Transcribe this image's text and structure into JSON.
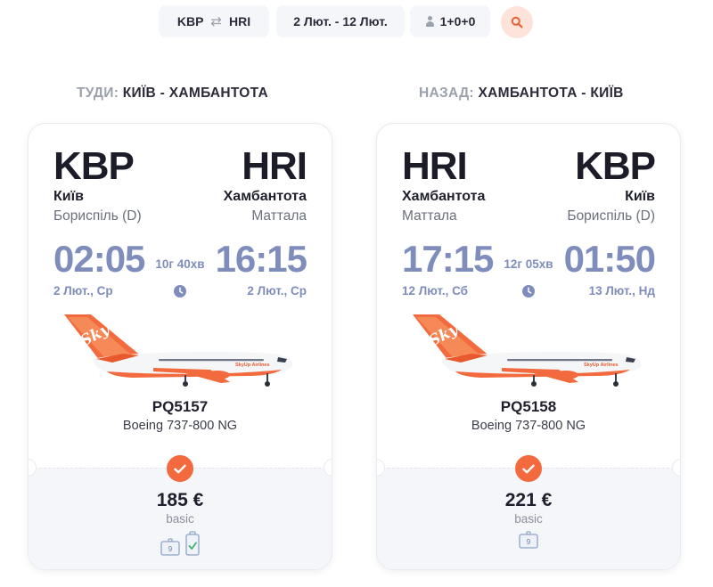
{
  "search": {
    "origin": "KBP",
    "destination": "HRI",
    "swap_glyph": "⇄",
    "dates": "2 Лют. - 12 Лют.",
    "passengers": "1+0+0"
  },
  "outbound": {
    "heading_prefix": "ТУДИ:",
    "heading_route": "КИЇВ - ХАМБАНТОТА",
    "from_code": "KBP",
    "to_code": "HRI",
    "from_city": "Київ",
    "to_city": "Хамбантота",
    "from_airport": "Бориспіль (D)",
    "to_airport": "Маттала",
    "depart_time": "02:05",
    "arrive_time": "16:15",
    "duration": "10г 40хв",
    "depart_date": "2 Лют., Ср",
    "arrive_date": "2 Лют., Ср",
    "flight_number": "PQ5157",
    "aircraft": "Boeing 737-800 NG",
    "price": "185 €",
    "fare": "basic",
    "bags": [
      "hand-luggage-icon",
      "checked-bag-icon"
    ],
    "hand_luggage_weight": "9"
  },
  "return": {
    "heading_prefix": "НАЗАД:",
    "heading_route": "ХАМБАНТОТА - КИЇВ",
    "from_code": "HRI",
    "to_code": "KBP",
    "from_city": "Хамбантота",
    "to_city": "Київ",
    "from_airport": "Маттала",
    "to_airport": "Бориспіль (D)",
    "depart_time": "17:15",
    "arrive_time": "01:50",
    "duration": "12г 05хв",
    "depart_date": "12 Лют., Сб",
    "arrive_date": "13 Лют., Нд",
    "flight_number": "PQ5158",
    "aircraft": "Boeing 737-800 NG",
    "price": "221 €",
    "fare": "basic",
    "bags": [
      "hand-luggage-icon"
    ],
    "hand_luggage_weight": "9"
  },
  "airline_logo_text": "SkyUp Airlines",
  "colors": {
    "accent": "#f26a3d",
    "time_blue": "#7f8dbd",
    "muted": "#9aa0ac",
    "card_bottom": "#f4f6fa"
  }
}
